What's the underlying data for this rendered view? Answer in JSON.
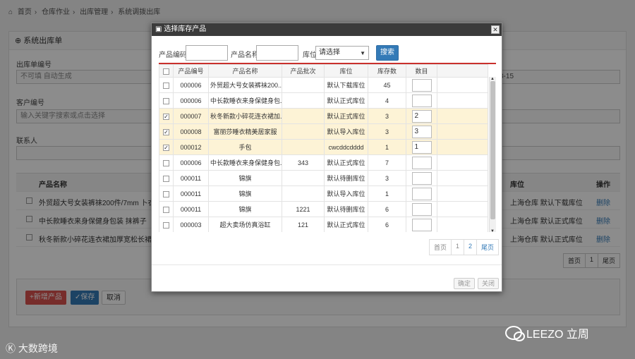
{
  "breadcrumb": [
    "首页",
    "仓库作业",
    "出库管理",
    "系统调拨出库"
  ],
  "page": {
    "panel_title": "系统出库单",
    "order_no_label": "出库单编号",
    "order_no_placeholder": "不可填 自动生成",
    "customer_label": "客户编号",
    "customer_placeholder": "输入关键字搜索或点击选择",
    "contact_label": "联系人",
    "right_value": "3-15",
    "table_head": {
      "name": "产品名称",
      "location": "库位",
      "op": "操作"
    },
    "rows": [
      {
        "name": "外贸超大号女装裤袜200件/7mm 卜衣物潮包袋行",
        "location": "上海仓库 默认下载库位",
        "op": "删除"
      },
      {
        "name": "中长款睡衣来身保健身包装   抹裤子",
        "location": "上海仓库 默认正式库位",
        "op": "删除"
      },
      {
        "name": "秋冬新款小碎花连衣裙加厚宽松长裙复古中式衣服",
        "location": "上海仓库 默认正式库位",
        "op": "删除"
      }
    ],
    "pager": [
      "首页",
      "1",
      "尾页"
    ],
    "add_button": "+新增产品",
    "save_button": "✓保存",
    "cancel_button": "取消"
  },
  "modal": {
    "title": "选择库存产品",
    "search": {
      "code_label": "产品编码",
      "name_label": "产品名称",
      "location_label": "库位",
      "location_value": "请选择",
      "search_button": "搜索"
    },
    "columns": [
      "产品编号",
      "产品名称",
      "产品批次",
      "库位",
      "库存数",
      "数目"
    ],
    "rows": [
      {
        "checked": false,
        "code": "000006",
        "name": "外贸超大号女装裤袜200...",
        "batch": "",
        "location": "默认下载库位",
        "stock": "45",
        "qty": ""
      },
      {
        "checked": false,
        "code": "000006",
        "name": "中长款睡衣来身保健身包...",
        "batch": "",
        "location": "默认正式库位",
        "stock": "4",
        "qty": ""
      },
      {
        "checked": true,
        "code": "000007",
        "name": "秋冬新款小碎花连衣裙加...",
        "batch": "",
        "location": "默认正式库位",
        "stock": "3",
        "qty": "2"
      },
      {
        "checked": true,
        "code": "000008",
        "name": "富丽莎睡衣精美居家服",
        "batch": "",
        "location": "默认导入库位",
        "stock": "3",
        "qty": "3"
      },
      {
        "checked": true,
        "code": "000012",
        "name": "手包",
        "batch": "",
        "location": "cwcddcdddd",
        "stock": "1",
        "qty": "1"
      },
      {
        "checked": false,
        "code": "000006",
        "name": "中长款睡衣来身保健身包...",
        "batch": "343",
        "location": "默认正式库位",
        "stock": "7",
        "qty": ""
      },
      {
        "checked": false,
        "code": "000011",
        "name": "锦旗",
        "batch": "",
        "location": "默认待删库位",
        "stock": "3",
        "qty": ""
      },
      {
        "checked": false,
        "code": "000011",
        "name": "锦旗",
        "batch": "",
        "location": "默认导入库位",
        "stock": "1",
        "qty": ""
      },
      {
        "checked": false,
        "code": "000011",
        "name": "锦旗",
        "batch": "1221",
        "location": "默认待删库位",
        "stock": "6",
        "qty": ""
      },
      {
        "checked": false,
        "code": "000003",
        "name": "超大卖场仿真浴缸",
        "batch": "121",
        "location": "默认正式库位",
        "stock": "6",
        "qty": ""
      }
    ],
    "pager": [
      "首页",
      "1",
      "2",
      "尾页"
    ],
    "confirm_button": "确定",
    "close_button": "关闭"
  },
  "watermarks": {
    "left": "大数跨境",
    "right": "LEEZO 立周"
  }
}
